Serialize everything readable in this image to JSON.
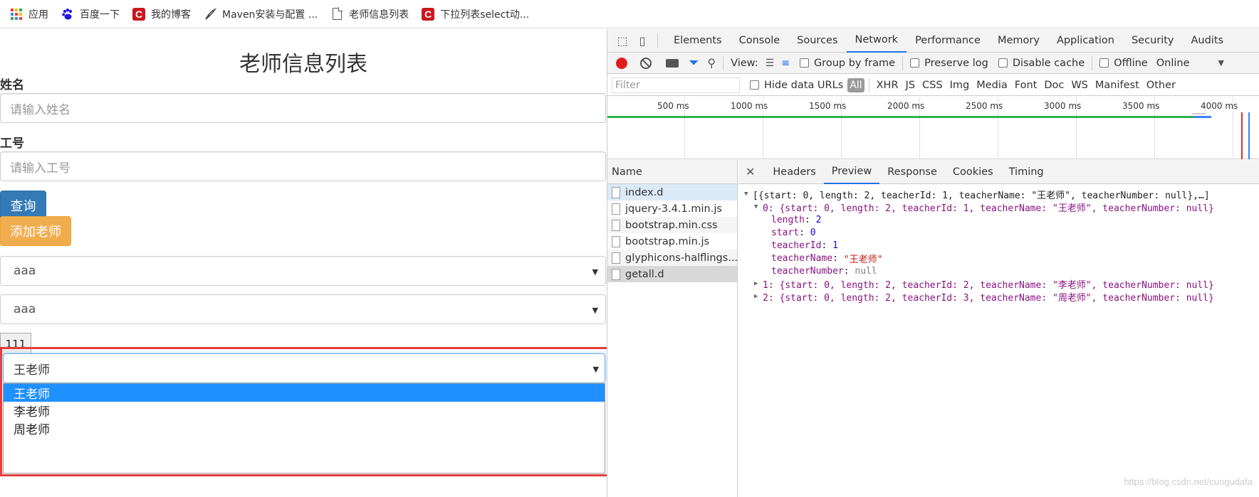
{
  "bookmarks": [
    {
      "label": "应用",
      "icon": "apps-grid-icon"
    },
    {
      "label": "百度一下",
      "icon": "baidu-paw-icon"
    },
    {
      "label": "我的博客",
      "icon": "csdn-icon"
    },
    {
      "label": "Maven安装与配置 ...",
      "icon": "maven-feather-icon"
    },
    {
      "label": "老师信息列表",
      "icon": "document-icon"
    },
    {
      "label": "下拉列表select动...",
      "icon": "csdn-icon"
    }
  ],
  "page": {
    "title": "老师信息列表",
    "name_label": "姓名",
    "name_placeholder": "请输入姓名",
    "number_label": "工号",
    "number_placeholder": "请输入工号",
    "query_button": "查询",
    "add_button": "添加老师",
    "select1_value": "aaa",
    "select2_value": "aaa",
    "small_button": "111",
    "teacher_select_value": "王老师",
    "teacher_options": [
      "王老师",
      "李老师",
      "周老师"
    ]
  },
  "devtools": {
    "tabs": [
      "Elements",
      "Console",
      "Sources",
      "Network",
      "Performance",
      "Memory",
      "Application",
      "Security",
      "Audits"
    ],
    "active_tab": "Network",
    "toolbar": {
      "view_label": "View:",
      "group_by_frame": "Group by frame",
      "preserve_log": "Preserve log",
      "disable_cache": "Disable cache",
      "offline": "Offline",
      "online": "Online"
    },
    "filter_bar": {
      "filter_placeholder": "Filter",
      "hide_data_urls": "Hide data URLs",
      "types": [
        "All",
        "XHR",
        "JS",
        "CSS",
        "Img",
        "Media",
        "Font",
        "Doc",
        "WS",
        "Manifest",
        "Other"
      ]
    },
    "timeline_ticks": [
      "500 ms",
      "1000 ms",
      "1500 ms",
      "2000 ms",
      "2500 ms",
      "3000 ms",
      "3500 ms",
      "4000 ms"
    ],
    "name_header": "Name",
    "requests": [
      "index.d",
      "jquery-3.4.1.min.js",
      "bootstrap.min.css",
      "bootstrap.min.js",
      "glyphicons-halflings...",
      "getall.d"
    ],
    "preview_tabs": [
      "Headers",
      "Preview",
      "Response",
      "Cookies",
      "Timing"
    ],
    "active_preview_tab": "Preview",
    "preview": {
      "root": "[{start: 0, length: 2, teacherId: 1, teacherName: \"王老师\", teacherNumber: null},…]",
      "item0": "0: {start: 0, length: 2, teacherId: 1, teacherName: \"王老师\", teacherNumber: null}",
      "fields": [
        {
          "key": "length",
          "value": "2",
          "kind": "n"
        },
        {
          "key": "start",
          "value": "0",
          "kind": "n"
        },
        {
          "key": "teacherId",
          "value": "1",
          "kind": "n"
        },
        {
          "key": "teacherName",
          "value": "\"王老师\"",
          "kind": "s"
        },
        {
          "key": "teacherNumber",
          "value": "null",
          "kind": "nul"
        }
      ],
      "item1": "1: {start: 0, length: 2, teacherId: 2, teacherName: \"李老师\", teacherNumber: null}",
      "item2": "2: {start: 0, length: 2, teacherId: 3, teacherName: \"周老师\", teacherNumber: null}"
    }
  },
  "watermark": "https://blog.csdn.net/cungudafa",
  "colors": {
    "primary": "#337ab7",
    "warning": "#f0ad4e",
    "highlight_frame": "#e83b3b",
    "option_selected": "#1e90ff",
    "devtools_accent": "#1a73e8"
  }
}
